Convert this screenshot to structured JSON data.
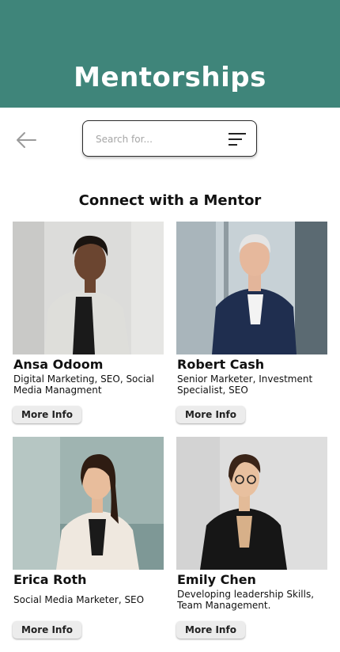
{
  "header": {
    "title": "Mentorships"
  },
  "search": {
    "placeholder": "Search for..."
  },
  "section": {
    "title": "Connect with a Mentor"
  },
  "mentors": [
    {
      "name": "Ansa Odoom",
      "description": "Digital Marketing, SEO, Social Media Managment",
      "button": "More Info"
    },
    {
      "name": "Robert Cash",
      "description": "Senior Marketer, Investment Specialist, SEO",
      "button": "More Info"
    },
    {
      "name": "Erica Roth",
      "description": "Social Media Marketer, SEO",
      "button": "More Info"
    },
    {
      "name": "Emily Chen",
      "description": "Developing leadership Skills, Team Management.",
      "button": "More Info"
    }
  ],
  "colors": {
    "header_bg": "#3f857a",
    "button_bg": "#ececec"
  },
  "icons": {
    "back": "back-arrow-icon",
    "filter": "filter-icon"
  }
}
